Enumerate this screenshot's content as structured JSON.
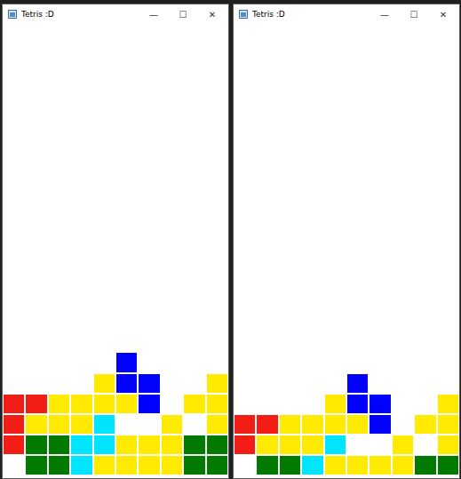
{
  "windows": [
    {
      "title": "Tetris :D",
      "controls": {
        "minimize": "—",
        "maximize": "☐",
        "close": "✕"
      },
      "board": [
        [
          "",
          "",
          "",
          "",
          "",
          "",
          "",
          "",
          "",
          ""
        ],
        [
          "",
          "",
          "",
          "",
          "",
          "",
          "",
          "",
          "",
          ""
        ],
        [
          "",
          "",
          "",
          "",
          "",
          "",
          "",
          "",
          "",
          ""
        ],
        [
          "",
          "",
          "",
          "",
          "",
          "",
          "",
          "",
          "",
          ""
        ],
        [
          "",
          "",
          "",
          "",
          "",
          "",
          "",
          "",
          "",
          ""
        ],
        [
          "",
          "",
          "",
          "",
          "",
          "",
          "",
          "",
          "",
          ""
        ],
        [
          "",
          "",
          "",
          "",
          "",
          "",
          "",
          "",
          "",
          ""
        ],
        [
          "",
          "",
          "",
          "",
          "",
          "",
          "",
          "",
          "",
          ""
        ],
        [
          "",
          "",
          "",
          "",
          "",
          "",
          "",
          "",
          "",
          ""
        ],
        [
          "",
          "",
          "",
          "",
          "",
          "",
          "",
          "",
          "",
          ""
        ],
        [
          "",
          "",
          "",
          "",
          "",
          "",
          "",
          "",
          "",
          ""
        ],
        [
          "",
          "",
          "",
          "",
          "",
          "",
          "",
          "",
          "",
          ""
        ],
        [
          "",
          "",
          "",
          "",
          "",
          "",
          "",
          "",
          "",
          ""
        ],
        [
          "",
          "",
          "",
          "",
          "",
          "",
          "",
          "",
          "",
          ""
        ],
        [
          "",
          "",
          "",
          "",
          "",
          "",
          "",
          "",
          "",
          ""
        ],
        [
          "",
          "",
          "",
          "",
          "",
          "",
          "",
          "",
          "",
          ""
        ],
        [
          "",
          "",
          "",
          "",
          "",
          "#0000ff",
          "",
          "",
          "",
          ""
        ],
        [
          "",
          "",
          "",
          "",
          "#ffea00",
          "#0000ff",
          "#0000ff",
          "",
          "",
          "#ffea00"
        ],
        [
          "#f21d14",
          "#f21d14",
          "#ffea00",
          "#ffea00",
          "#ffea00",
          "#ffea00",
          "#0000ff",
          "",
          "#ffea00",
          "#ffea00"
        ],
        [
          "#f21d14",
          "#ffea00",
          "#ffea00",
          "#ffea00",
          "#00e5ff",
          "",
          "",
          "#ffea00",
          "",
          "#ffea00"
        ],
        [
          "#f21d14",
          "#007a00",
          "#007a00",
          "#00e5ff",
          "#00e5ff",
          "#ffea00",
          "#ffea00",
          "#ffea00",
          "#007a00",
          "#007a00"
        ],
        [
          "",
          "#007a00",
          "#007a00",
          "#00e5ff",
          "#ffea00",
          "#ffea00",
          "#ffea00",
          "#ffea00",
          "#007a00",
          "#007a00"
        ]
      ]
    },
    {
      "title": "Tetris :D",
      "controls": {
        "minimize": "—",
        "maximize": "☐",
        "close": "✕"
      },
      "board": [
        [
          "",
          "",
          "",
          "",
          "",
          "",
          "",
          "",
          "",
          ""
        ],
        [
          "",
          "",
          "",
          "",
          "",
          "",
          "",
          "",
          "",
          ""
        ],
        [
          "",
          "",
          "",
          "",
          "",
          "",
          "",
          "",
          "",
          ""
        ],
        [
          "",
          "",
          "",
          "",
          "",
          "",
          "",
          "",
          "",
          ""
        ],
        [
          "",
          "",
          "",
          "",
          "",
          "",
          "",
          "",
          "",
          ""
        ],
        [
          "",
          "",
          "",
          "",
          "",
          "",
          "",
          "",
          "",
          ""
        ],
        [
          "",
          "",
          "",
          "",
          "",
          "",
          "",
          "",
          "",
          ""
        ],
        [
          "",
          "",
          "",
          "",
          "",
          "",
          "",
          "",
          "",
          ""
        ],
        [
          "",
          "",
          "",
          "",
          "",
          "",
          "",
          "",
          "",
          ""
        ],
        [
          "",
          "",
          "",
          "",
          "",
          "",
          "",
          "",
          "",
          ""
        ],
        [
          "",
          "",
          "",
          "",
          "",
          "",
          "",
          "",
          "",
          ""
        ],
        [
          "",
          "",
          "",
          "",
          "",
          "",
          "",
          "",
          "",
          ""
        ],
        [
          "",
          "",
          "",
          "",
          "",
          "",
          "",
          "",
          "",
          ""
        ],
        [
          "",
          "",
          "",
          "",
          "",
          "",
          "",
          "",
          "",
          ""
        ],
        [
          "",
          "",
          "",
          "",
          "",
          "",
          "",
          "",
          "",
          ""
        ],
        [
          "",
          "",
          "",
          "",
          "",
          "",
          "",
          "",
          "",
          ""
        ],
        [
          "",
          "",
          "",
          "",
          "",
          "",
          "",
          "",
          "",
          ""
        ],
        [
          "",
          "",
          "",
          "",
          "",
          "#0000ff",
          "",
          "",
          "",
          ""
        ],
        [
          "",
          "",
          "",
          "",
          "#ffea00",
          "#0000ff",
          "#0000ff",
          "",
          "",
          "#ffea00"
        ],
        [
          "#f21d14",
          "#f21d14",
          "#ffea00",
          "#ffea00",
          "#ffea00",
          "#ffea00",
          "#0000ff",
          "",
          "#ffea00",
          "#ffea00"
        ],
        [
          "#f21d14",
          "#ffea00",
          "#ffea00",
          "#ffea00",
          "#00e5ff",
          "",
          "",
          "#ffea00",
          "",
          "#ffea00"
        ],
        [
          "",
          "#007a00",
          "#007a00",
          "#00e5ff",
          "#ffea00",
          "#ffea00",
          "#ffea00",
          "#ffea00",
          "#007a00",
          "#007a00"
        ]
      ]
    }
  ]
}
